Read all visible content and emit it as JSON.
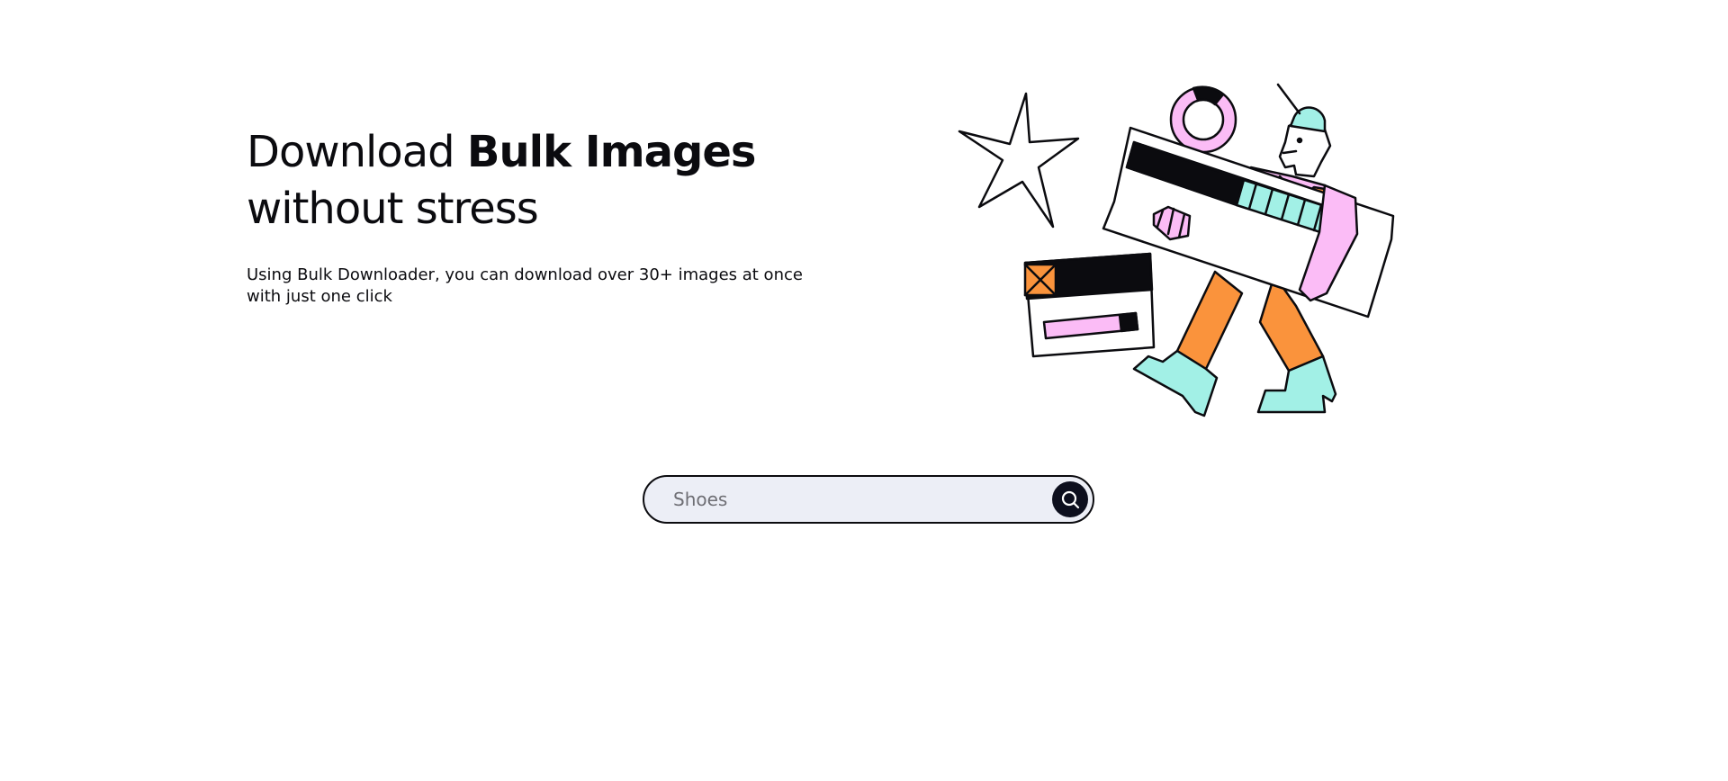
{
  "hero": {
    "headline_regular": "Download ",
    "headline_bold": "Bulk Images",
    "headline_line2": "without stress",
    "description": "Using Bulk Downloader, you can download over 30+ images at once with just one click"
  },
  "illustration": {
    "icon": "person-carrying-download-progress-illustration",
    "colors": {
      "pink": "#fbbcf6",
      "orange": "#fa933c",
      "mint": "#a2f0e6",
      "outline": "#0b0b0f"
    }
  },
  "search": {
    "placeholder": "Shoes",
    "value": "",
    "button_icon": "search-icon",
    "field_bg": "#eceef6",
    "button_bg": "#0d0f1e"
  }
}
